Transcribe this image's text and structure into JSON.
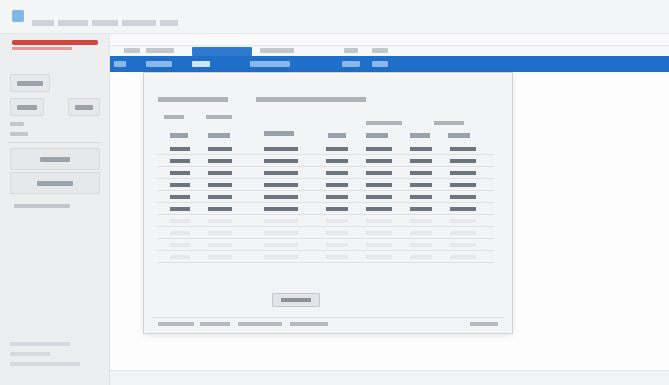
{
  "window": {
    "title": ""
  },
  "sidebar": {
    "brand": "",
    "buttons": [
      "",
      "",
      "",
      "",
      ""
    ],
    "lines": [
      "",
      "",
      ""
    ]
  },
  "menubar": {
    "items": [
      "",
      "",
      "",
      "",
      "",
      ""
    ]
  },
  "ribbon": {
    "tabs": [
      "",
      "",
      "",
      "",
      "",
      ""
    ]
  },
  "dialog": {
    "title": "",
    "subtitle": "",
    "groups": [
      "",
      "",
      "",
      ""
    ],
    "columns": [
      "",
      "",
      "",
      "",
      "",
      "",
      ""
    ],
    "rows": [
      [
        "",
        "",
        "",
        "",
        "",
        "",
        ""
      ],
      [
        "",
        "",
        "",
        "",
        "",
        "",
        ""
      ],
      [
        "",
        "",
        "",
        "",
        "",
        "",
        ""
      ],
      [
        "",
        "",
        "",
        "",
        "",
        "",
        ""
      ],
      [
        "",
        "",
        "",
        "",
        "",
        "",
        ""
      ],
      [
        "",
        "",
        "",
        "",
        "",
        "",
        ""
      ],
      [
        "",
        "",
        "",
        "",
        "",
        "",
        ""
      ],
      [
        "",
        "",
        "",
        "",
        "",
        "",
        ""
      ],
      [
        "",
        "",
        "",
        "",
        "",
        "",
        ""
      ],
      [
        "",
        "",
        "",
        "",
        "",
        "",
        ""
      ]
    ],
    "ok_label": "",
    "status": [
      "",
      "",
      "",
      "",
      ""
    ]
  }
}
